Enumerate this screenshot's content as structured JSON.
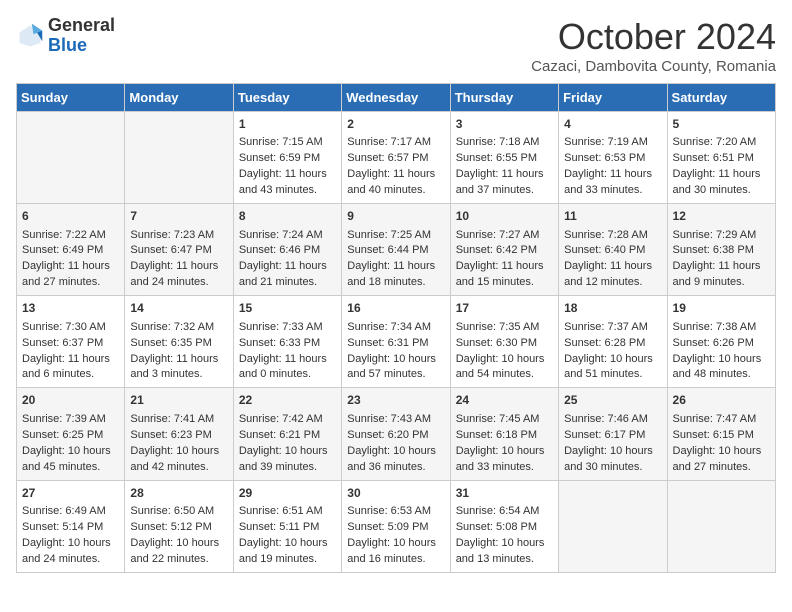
{
  "header": {
    "logo_general": "General",
    "logo_blue": "Blue",
    "month": "October 2024",
    "location": "Cazaci, Dambovita County, Romania"
  },
  "days_of_week": [
    "Sunday",
    "Monday",
    "Tuesday",
    "Wednesday",
    "Thursday",
    "Friday",
    "Saturday"
  ],
  "weeks": [
    [
      {
        "day": "",
        "sunrise": "",
        "sunset": "",
        "daylight": ""
      },
      {
        "day": "",
        "sunrise": "",
        "sunset": "",
        "daylight": ""
      },
      {
        "day": "1",
        "sunrise": "Sunrise: 7:15 AM",
        "sunset": "Sunset: 6:59 PM",
        "daylight": "Daylight: 11 hours and 43 minutes."
      },
      {
        "day": "2",
        "sunrise": "Sunrise: 7:17 AM",
        "sunset": "Sunset: 6:57 PM",
        "daylight": "Daylight: 11 hours and 40 minutes."
      },
      {
        "day": "3",
        "sunrise": "Sunrise: 7:18 AM",
        "sunset": "Sunset: 6:55 PM",
        "daylight": "Daylight: 11 hours and 37 minutes."
      },
      {
        "day": "4",
        "sunrise": "Sunrise: 7:19 AM",
        "sunset": "Sunset: 6:53 PM",
        "daylight": "Daylight: 11 hours and 33 minutes."
      },
      {
        "day": "5",
        "sunrise": "Sunrise: 7:20 AM",
        "sunset": "Sunset: 6:51 PM",
        "daylight": "Daylight: 11 hours and 30 minutes."
      }
    ],
    [
      {
        "day": "6",
        "sunrise": "Sunrise: 7:22 AM",
        "sunset": "Sunset: 6:49 PM",
        "daylight": "Daylight: 11 hours and 27 minutes."
      },
      {
        "day": "7",
        "sunrise": "Sunrise: 7:23 AM",
        "sunset": "Sunset: 6:47 PM",
        "daylight": "Daylight: 11 hours and 24 minutes."
      },
      {
        "day": "8",
        "sunrise": "Sunrise: 7:24 AM",
        "sunset": "Sunset: 6:46 PM",
        "daylight": "Daylight: 11 hours and 21 minutes."
      },
      {
        "day": "9",
        "sunrise": "Sunrise: 7:25 AM",
        "sunset": "Sunset: 6:44 PM",
        "daylight": "Daylight: 11 hours and 18 minutes."
      },
      {
        "day": "10",
        "sunrise": "Sunrise: 7:27 AM",
        "sunset": "Sunset: 6:42 PM",
        "daylight": "Daylight: 11 hours and 15 minutes."
      },
      {
        "day": "11",
        "sunrise": "Sunrise: 7:28 AM",
        "sunset": "Sunset: 6:40 PM",
        "daylight": "Daylight: 11 hours and 12 minutes."
      },
      {
        "day": "12",
        "sunrise": "Sunrise: 7:29 AM",
        "sunset": "Sunset: 6:38 PM",
        "daylight": "Daylight: 11 hours and 9 minutes."
      }
    ],
    [
      {
        "day": "13",
        "sunrise": "Sunrise: 7:30 AM",
        "sunset": "Sunset: 6:37 PM",
        "daylight": "Daylight: 11 hours and 6 minutes."
      },
      {
        "day": "14",
        "sunrise": "Sunrise: 7:32 AM",
        "sunset": "Sunset: 6:35 PM",
        "daylight": "Daylight: 11 hours and 3 minutes."
      },
      {
        "day": "15",
        "sunrise": "Sunrise: 7:33 AM",
        "sunset": "Sunset: 6:33 PM",
        "daylight": "Daylight: 11 hours and 0 minutes."
      },
      {
        "day": "16",
        "sunrise": "Sunrise: 7:34 AM",
        "sunset": "Sunset: 6:31 PM",
        "daylight": "Daylight: 10 hours and 57 minutes."
      },
      {
        "day": "17",
        "sunrise": "Sunrise: 7:35 AM",
        "sunset": "Sunset: 6:30 PM",
        "daylight": "Daylight: 10 hours and 54 minutes."
      },
      {
        "day": "18",
        "sunrise": "Sunrise: 7:37 AM",
        "sunset": "Sunset: 6:28 PM",
        "daylight": "Daylight: 10 hours and 51 minutes."
      },
      {
        "day": "19",
        "sunrise": "Sunrise: 7:38 AM",
        "sunset": "Sunset: 6:26 PM",
        "daylight": "Daylight: 10 hours and 48 minutes."
      }
    ],
    [
      {
        "day": "20",
        "sunrise": "Sunrise: 7:39 AM",
        "sunset": "Sunset: 6:25 PM",
        "daylight": "Daylight: 10 hours and 45 minutes."
      },
      {
        "day": "21",
        "sunrise": "Sunrise: 7:41 AM",
        "sunset": "Sunset: 6:23 PM",
        "daylight": "Daylight: 10 hours and 42 minutes."
      },
      {
        "day": "22",
        "sunrise": "Sunrise: 7:42 AM",
        "sunset": "Sunset: 6:21 PM",
        "daylight": "Daylight: 10 hours and 39 minutes."
      },
      {
        "day": "23",
        "sunrise": "Sunrise: 7:43 AM",
        "sunset": "Sunset: 6:20 PM",
        "daylight": "Daylight: 10 hours and 36 minutes."
      },
      {
        "day": "24",
        "sunrise": "Sunrise: 7:45 AM",
        "sunset": "Sunset: 6:18 PM",
        "daylight": "Daylight: 10 hours and 33 minutes."
      },
      {
        "day": "25",
        "sunrise": "Sunrise: 7:46 AM",
        "sunset": "Sunset: 6:17 PM",
        "daylight": "Daylight: 10 hours and 30 minutes."
      },
      {
        "day": "26",
        "sunrise": "Sunrise: 7:47 AM",
        "sunset": "Sunset: 6:15 PM",
        "daylight": "Daylight: 10 hours and 27 minutes."
      }
    ],
    [
      {
        "day": "27",
        "sunrise": "Sunrise: 6:49 AM",
        "sunset": "Sunset: 5:14 PM",
        "daylight": "Daylight: 10 hours and 24 minutes."
      },
      {
        "day": "28",
        "sunrise": "Sunrise: 6:50 AM",
        "sunset": "Sunset: 5:12 PM",
        "daylight": "Daylight: 10 hours and 22 minutes."
      },
      {
        "day": "29",
        "sunrise": "Sunrise: 6:51 AM",
        "sunset": "Sunset: 5:11 PM",
        "daylight": "Daylight: 10 hours and 19 minutes."
      },
      {
        "day": "30",
        "sunrise": "Sunrise: 6:53 AM",
        "sunset": "Sunset: 5:09 PM",
        "daylight": "Daylight: 10 hours and 16 minutes."
      },
      {
        "day": "31",
        "sunrise": "Sunrise: 6:54 AM",
        "sunset": "Sunset: 5:08 PM",
        "daylight": "Daylight: 10 hours and 13 minutes."
      },
      {
        "day": "",
        "sunrise": "",
        "sunset": "",
        "daylight": ""
      },
      {
        "day": "",
        "sunrise": "",
        "sunset": "",
        "daylight": ""
      }
    ]
  ]
}
